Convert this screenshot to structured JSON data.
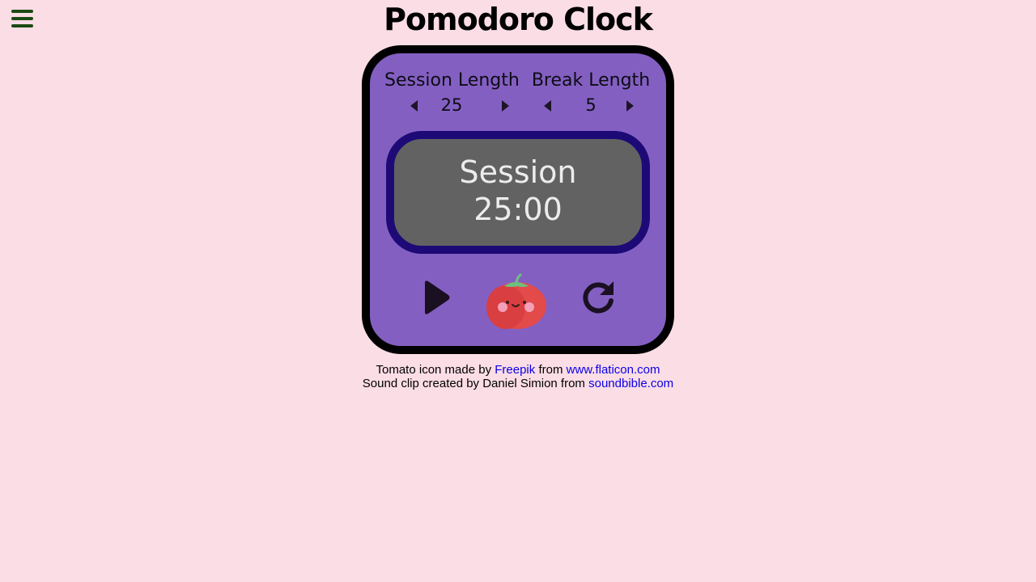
{
  "page": {
    "title": "Pomodoro Clock"
  },
  "menu": {
    "icon": "hamburger-menu-icon"
  },
  "session": {
    "label": "Session Length",
    "value": "25"
  },
  "break": {
    "label": "Break Length",
    "value": "5"
  },
  "timer": {
    "mode": "Session",
    "time": "25:00"
  },
  "controls": {
    "play_icon": "play-icon",
    "tomato_icon": "tomato-icon",
    "reset_icon": "reset-icon"
  },
  "credits": {
    "line1_prefix": "Tomato icon made by ",
    "line1_author": "Freepik",
    "line1_mid": " from ",
    "line1_site": "www.flaticon.com",
    "line2_prefix": "Sound clip created by Daniel Simion from ",
    "line2_site": "soundbible.com"
  },
  "colors": {
    "background": "#fbdde6",
    "clock_face": "#845fc2",
    "timer_bg": "#626262",
    "timer_border": "#1d0a76",
    "link": "#0b00e6",
    "menu": "#1b4a12"
  }
}
